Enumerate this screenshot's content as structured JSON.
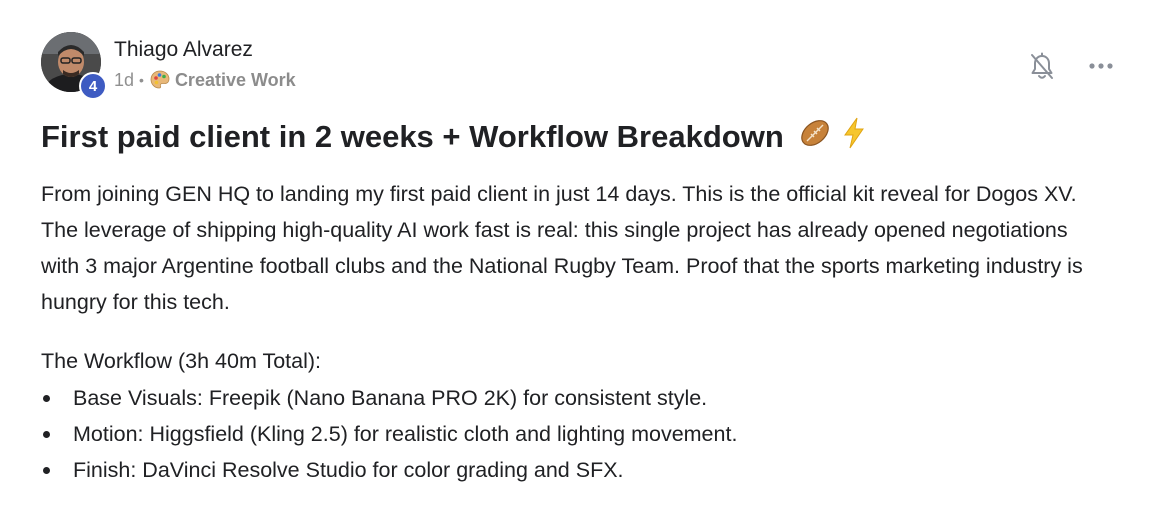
{
  "post": {
    "author": {
      "name": "Thiago Alvarez",
      "level": "4"
    },
    "time_ago": "1d",
    "separator": "•",
    "category": {
      "label": "Creative Work",
      "icon": "palette-icon"
    },
    "actions": {
      "notifications_icon": "bell-off-icon",
      "more_icon": "more-horizontal-icon"
    },
    "title": "First paid client in 2 weeks + Workflow Breakdown",
    "title_emojis": [
      "rugby-ball-icon",
      "lightning-icon"
    ],
    "body": "From joining GEN HQ to landing my first paid client in just 14 days. This is the official kit reveal for Dogos XV. The leverage of shipping high-quality AI work fast is real: this single project has already opened negotiations with 3 major Argentine football clubs and the National Rugby Team. Proof that the sports marketing industry is hungry for this tech.",
    "workflow": {
      "heading": "The Workflow (3h 40m Total):",
      "items": [
        "Base Visuals: Freepik (Nano Banana PRO 2K) for consistent style.",
        "Motion: Higgsfield (Kling 2.5) for realistic cloth and lighting movement.",
        "Finish: DaVinci Resolve Studio for color grading and SFX."
      ]
    }
  },
  "colors": {
    "text": "#202124",
    "muted": "#909090",
    "badge": "#3e5bc2",
    "icon": "#8a8f98"
  }
}
